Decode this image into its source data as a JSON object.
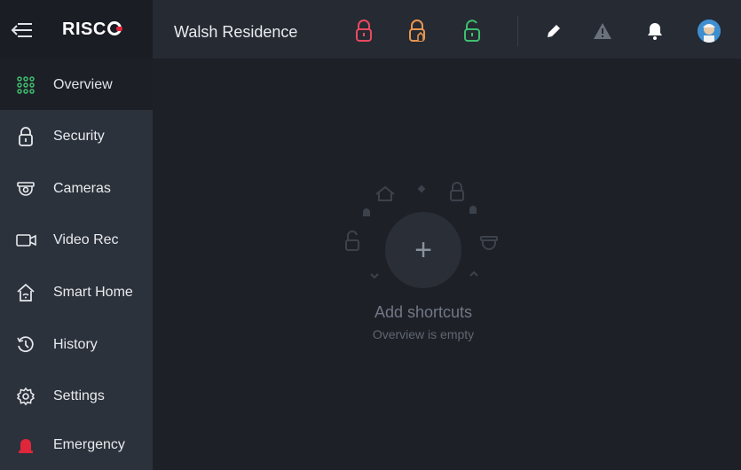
{
  "header": {
    "brand": "RISC",
    "site_name": "Walsh Residence",
    "icons": {
      "menu": "collapse-menu-icon",
      "lock_red": "armed-lock-icon",
      "lock_orange": "partial-lock-icon",
      "lock_green": "disarmed-lock-icon",
      "edit": "pencil-icon",
      "alert": "warning-icon",
      "bell": "bell-icon",
      "avatar": "avatar"
    },
    "colors": {
      "armed": "#e84a5f",
      "partial": "#e89550",
      "disarmed": "#3fbf6f"
    }
  },
  "sidebar": {
    "items": [
      {
        "label": "Overview",
        "icon": "overview-grid-icon",
        "active": true
      },
      {
        "label": "Security",
        "icon": "lock-icon"
      },
      {
        "label": "Cameras",
        "icon": "camera-icon"
      },
      {
        "label": "Video Rec",
        "icon": "video-icon"
      },
      {
        "label": "Smart Home",
        "icon": "smart-home-icon"
      },
      {
        "label": "History",
        "icon": "history-icon"
      },
      {
        "label": "Settings",
        "icon": "gear-icon"
      },
      {
        "label": "Emergency",
        "icon": "emergency-siren-icon"
      }
    ]
  },
  "main": {
    "empty_title": "Add shortcuts",
    "empty_subtitle": "Overview is empty",
    "add_label": "+"
  }
}
